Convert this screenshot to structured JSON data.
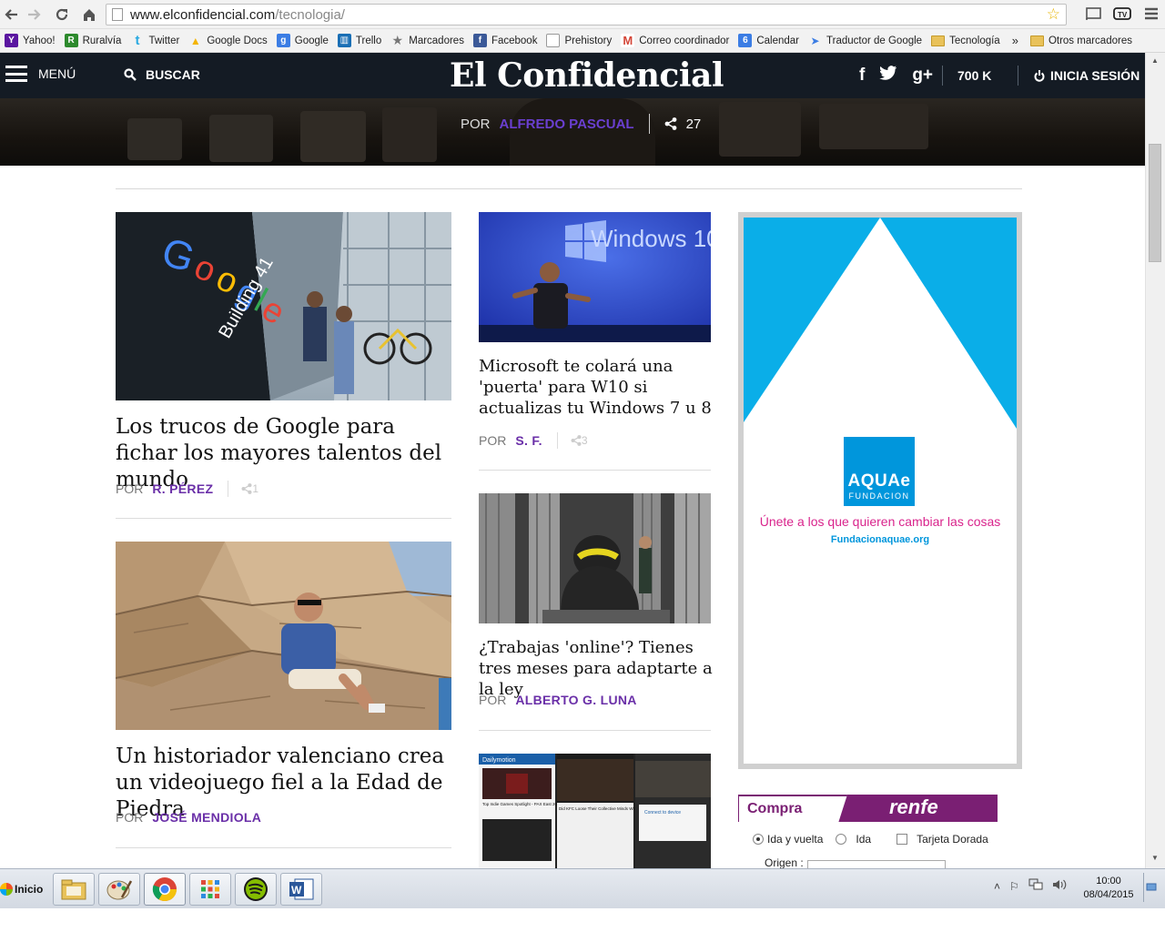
{
  "browser": {
    "url_host": "www.elconfidencial.com",
    "url_path": "/tecnologia/",
    "icons": [
      "back-icon",
      "forward-icon",
      "reload-icon",
      "home-icon",
      "bookmark-star-icon",
      "cast-icon",
      "tv-extension-icon",
      "chrome-menu-icon"
    ]
  },
  "bookmarks": {
    "items": [
      {
        "label": "Yahoo!",
        "icon": "yahoo-icon",
        "color": "#5a16a0",
        "glyph": "Y"
      },
      {
        "label": "Ruralvía",
        "icon": "ruralvia-icon",
        "color": "#2d8a2d",
        "glyph": "R"
      },
      {
        "label": "Twitter",
        "icon": "twitter-icon",
        "color": "#29a9e1",
        "glyph": "t"
      },
      {
        "label": "Google Docs",
        "icon": "google-docs-icon",
        "color": "#f4b400",
        "glyph": "▲"
      },
      {
        "label": "Google",
        "icon": "google-icon",
        "color": "#3b7de4",
        "glyph": "g"
      },
      {
        "label": "Trello",
        "icon": "trello-icon",
        "color": "#1a6fb5",
        "glyph": "▥"
      },
      {
        "label": "Marcadores",
        "icon": "star-icon",
        "color": "#777777",
        "glyph": "★"
      },
      {
        "label": "Facebook",
        "icon": "facebook-icon",
        "color": "#3b5998",
        "glyph": "f"
      },
      {
        "label": "Prehistory",
        "icon": "blank-page-icon",
        "color": "#ffffff",
        "glyph": ""
      },
      {
        "label": "Correo coordinador",
        "icon": "gmail-icon",
        "color": "#d44638",
        "glyph": "M"
      },
      {
        "label": "Calendar",
        "icon": "calendar-icon",
        "color": "#3b7de4",
        "glyph": "6"
      },
      {
        "label": "Traductor de Google",
        "icon": "translate-icon",
        "color": "#3b7de4",
        "glyph": "➤"
      },
      {
        "label": "Tecnología",
        "icon": "folder-icon",
        "color": "#e9c25a",
        "glyph": ""
      }
    ],
    "more": "»",
    "other": "Otros marcadores"
  },
  "header": {
    "menu_label": "MENÚ",
    "search_label": "BUSCAR",
    "logo": "El Confidencial",
    "social": [
      "f",
      "t",
      "g+"
    ],
    "followers": "700 K",
    "login_label": "INICIA SESIÓN"
  },
  "hero": {
    "by": "POR",
    "author": "ALFREDO PASCUAL",
    "shares": "27"
  },
  "articles": {
    "a1": {
      "title": "Los trucos de Google para fichar los mayores talentos del mundo",
      "by": "POR",
      "author": "R. PÉREZ",
      "shares": "1"
    },
    "a2": {
      "title": "Microsoft te colará una 'puerta' para W10 si actualizas tu Windows 7 u 8",
      "by": "POR",
      "author": "S. F.",
      "shares": "3"
    },
    "a3": {
      "title": "Un historiador valenciano crea un videojuego fiel a la Edad de Piedra",
      "by": "POR",
      "author": "JOSÉ MENDIOLA"
    },
    "a4": {
      "title": "¿Trabajas 'online'? Tienes tres meses para adaptarte a la ley",
      "by": "POR",
      "author": "ALBERTO G. LUNA"
    }
  },
  "image_text": {
    "google_sign": "Google",
    "building": "Building 41",
    "windows": "Windows 10",
    "dailymotion": "Dailymotion",
    "dm_headline1": "Top Indie Games Spotlight - PAX East 2014",
    "dm_headline2": "Did KFC Loose Their Collective Minds With This Ad?",
    "dm_connect": "Connect to device"
  },
  "ad": {
    "brand": "AQUAe",
    "brand_sub": "FUNDACION",
    "slogan": "Únete a los que quieren cambiar las cosas",
    "url": "Fundacionaquae.org",
    "colors": {
      "blue": "#0096dc",
      "magenta": "#d9248c"
    }
  },
  "renfe": {
    "tab": "Compra",
    "logo": "renfe",
    "opt_return": "Ida y vuelta",
    "opt_oneway": "Ida",
    "opt_card": "Tarjeta Dorada",
    "origin_label": "Origen :"
  },
  "taskbar": {
    "start_label": "Inicio",
    "apps": [
      "file-explorer-icon",
      "paint-icon",
      "chrome-icon",
      "apps-grid-icon",
      "spotify-icon",
      "word-icon"
    ],
    "time": "10:00",
    "date": "08/04/2015"
  }
}
